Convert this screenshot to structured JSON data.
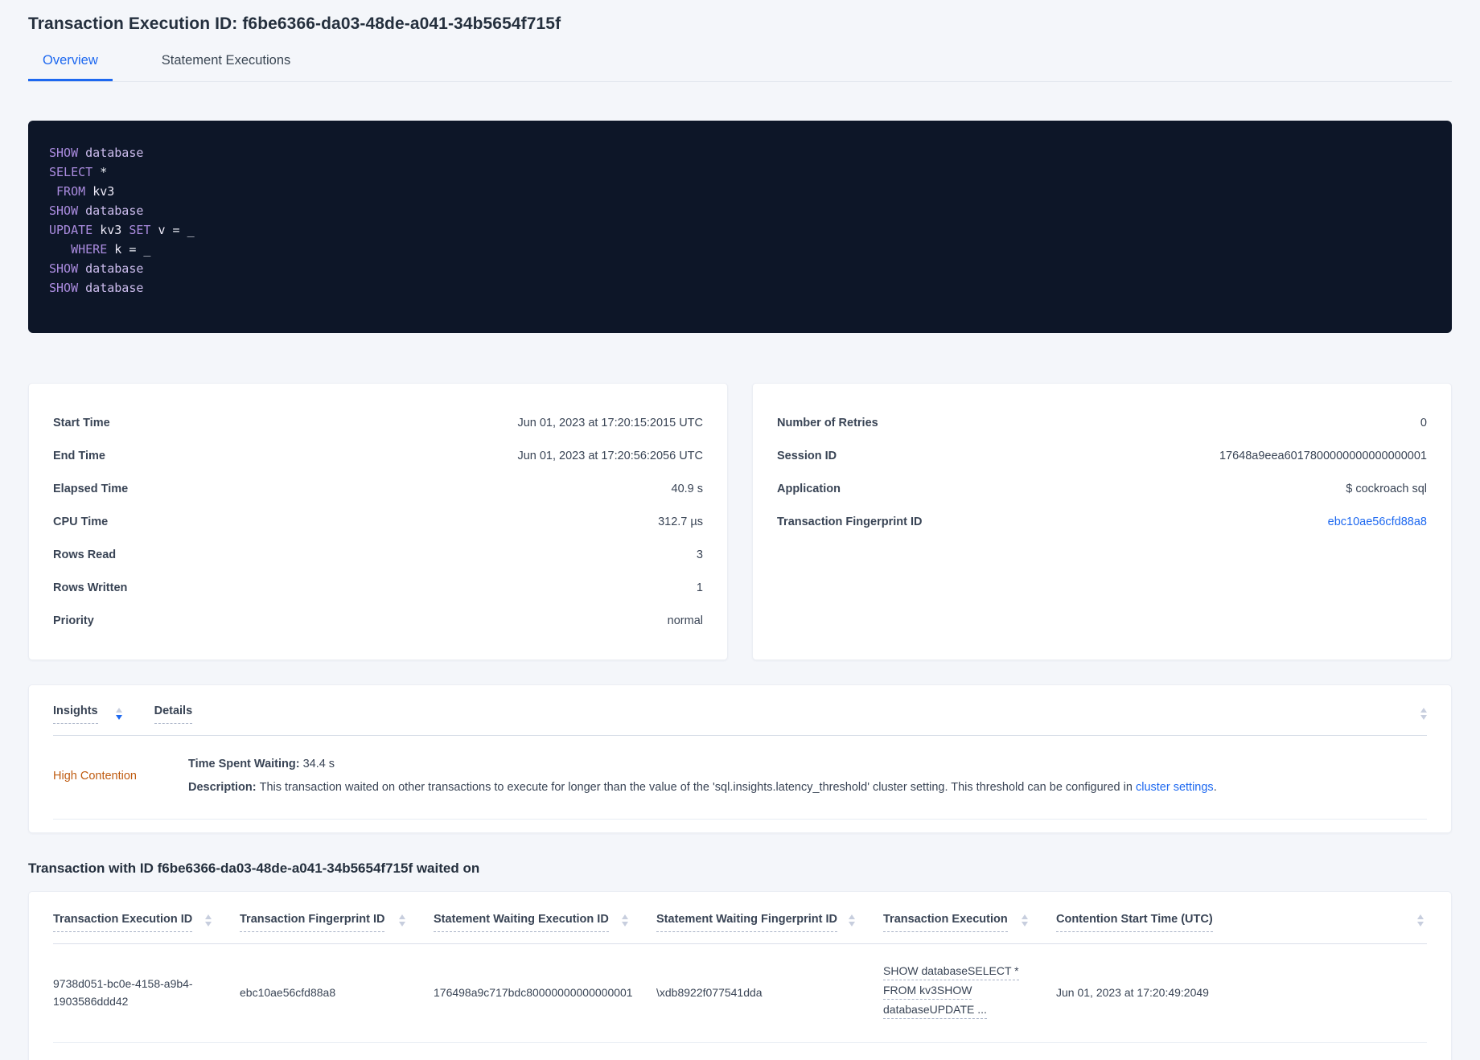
{
  "page": {
    "title": "Transaction Execution ID: f6be6366-da03-48de-a041-34b5654f715f"
  },
  "tabs": {
    "overview": "Overview",
    "statement_executions": "Statement Executions"
  },
  "sql": {
    "lines": [
      [
        {
          "t": "SHOW ",
          "c": "kw"
        },
        {
          "t": "database",
          "c": "id"
        }
      ],
      [
        {
          "t": "SELECT ",
          "c": "kw"
        },
        {
          "t": "*",
          "c": "op"
        }
      ],
      [
        {
          "t": " ",
          "c": "pl"
        },
        {
          "t": "FROM ",
          "c": "kw"
        },
        {
          "t": "kv3",
          "c": "nm"
        }
      ],
      [
        {
          "t": "SHOW ",
          "c": "kw"
        },
        {
          "t": "database",
          "c": "id"
        }
      ],
      [
        {
          "t": "UPDATE ",
          "c": "kw"
        },
        {
          "t": "kv3 ",
          "c": "nm"
        },
        {
          "t": "SET ",
          "c": "kw"
        },
        {
          "t": "v ",
          "c": "nm"
        },
        {
          "t": "= ",
          "c": "op"
        },
        {
          "t": "_",
          "c": "op"
        }
      ],
      [
        {
          "t": "   ",
          "c": "pl"
        },
        {
          "t": "WHERE ",
          "c": "kw"
        },
        {
          "t": "k ",
          "c": "nm"
        },
        {
          "t": "= ",
          "c": "op"
        },
        {
          "t": "_",
          "c": "op"
        }
      ],
      [
        {
          "t": "SHOW ",
          "c": "kw"
        },
        {
          "t": "database",
          "c": "id"
        }
      ],
      [
        {
          "t": "SHOW ",
          "c": "kw"
        },
        {
          "t": "database",
          "c": "id"
        }
      ]
    ]
  },
  "summary_left": {
    "rows": [
      {
        "label": "Start Time",
        "value": "Jun 01, 2023 at 17:20:15:2015 UTC"
      },
      {
        "label": "End Time",
        "value": "Jun 01, 2023 at 17:20:56:2056 UTC"
      },
      {
        "label": "Elapsed Time",
        "value": "40.9 s"
      },
      {
        "label": "CPU Time",
        "value": "312.7 µs"
      },
      {
        "label": "Rows Read",
        "value": "3"
      },
      {
        "label": "Rows Written",
        "value": "1"
      },
      {
        "label": "Priority",
        "value": "normal"
      }
    ]
  },
  "summary_right": {
    "rows": [
      {
        "label": "Number of Retries",
        "value": "0"
      },
      {
        "label": "Session ID",
        "value": "17648a9eea6017800000000000000001"
      },
      {
        "label": "Application",
        "value": "$ cockroach sql"
      },
      {
        "label": "Transaction Fingerprint ID",
        "value": "ebc10ae56cfd88a8",
        "link": true
      }
    ]
  },
  "insights": {
    "columns": [
      "Insights",
      "Details"
    ],
    "row": {
      "name": "High Contention",
      "waiting_label": "Time Spent Waiting:",
      "waiting_value": "34.4 s",
      "description_label": "Description:",
      "description_text": "This transaction waited on other transactions to execute for longer than the value of the 'sql.insights.latency_threshold' cluster setting. This threshold can be configured in ",
      "description_link": "cluster settings",
      "description_suffix": "."
    }
  },
  "waited_on": {
    "heading": "Transaction with ID f6be6366-da03-48de-a041-34b5654f715f waited on",
    "columns": [
      "Transaction Execution ID",
      "Transaction Fingerprint ID",
      "Statement Waiting Execution ID",
      "Statement Waiting Fingerprint ID",
      "Transaction Execution",
      "Contention Start Time (UTC)"
    ],
    "row": {
      "transaction_execution_id": "9738d051-bc0e-4158-a9b4-1903586ddd42",
      "transaction_fingerprint_id": "ebc10ae56cfd88a8",
      "statement_waiting_execution_id": "176498a9c717bdc80000000000000001",
      "statement_waiting_fingerprint_id": "\\xdb8922f077541dda",
      "transaction_execution_lines": [
        "SHOW databaseSELECT *",
        "FROM kv3SHOW",
        "databaseUPDATE ..."
      ],
      "contention_start_time": "Jun 01, 2023 at 17:20:49:2049"
    }
  },
  "colors": {
    "accent_blue": "#1d68f0",
    "insight_warning_orange": "#bf5b10",
    "code_background": "#0d1628",
    "code_keyword": "#ab8ce0",
    "code_identifier": "#cdbdee"
  }
}
